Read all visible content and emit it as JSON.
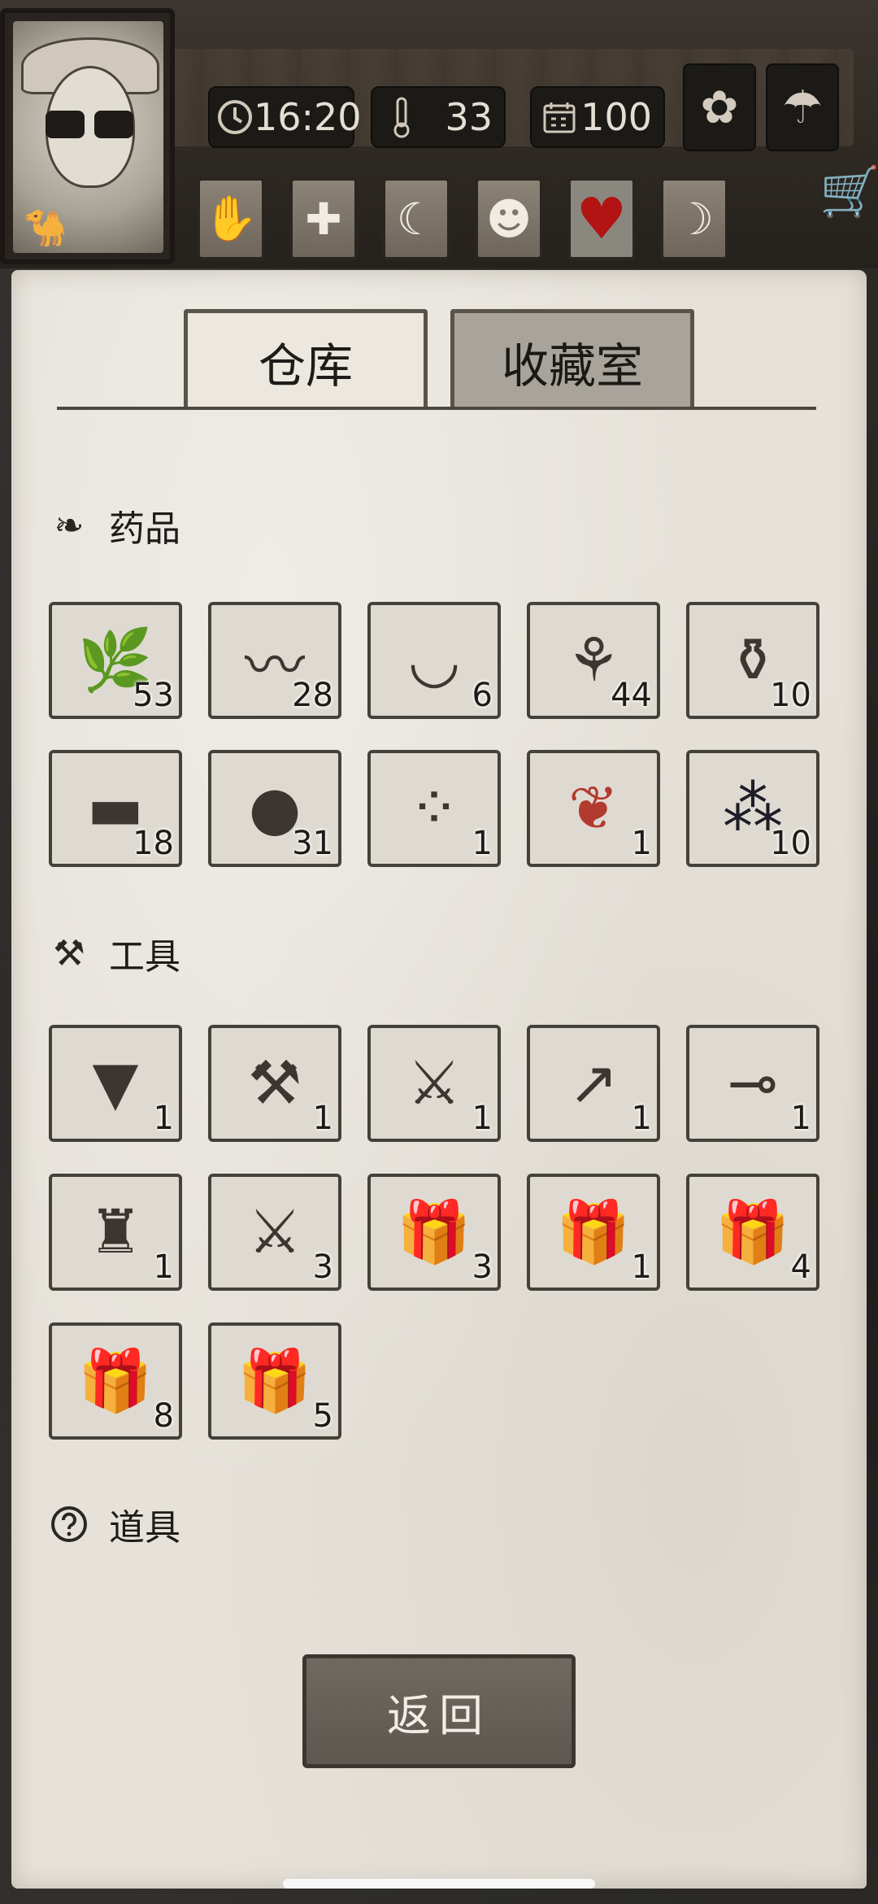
{
  "hud": {
    "time": "16:20",
    "temperature": "33",
    "day": "100"
  },
  "status_icons": [
    "hand-icon",
    "medical-cross-icon",
    "stomach-icon",
    "head-icon",
    "heart-icon",
    "moon-icon"
  ],
  "tabs": {
    "warehouse": "仓库",
    "collection": "收藏室"
  },
  "sections": {
    "medicine": {
      "title": "药品",
      "items": [
        {
          "name": "herb-branch",
          "qty": "53"
        },
        {
          "name": "bandage",
          "qty": "28"
        },
        {
          "name": "bowl",
          "qty": "6"
        },
        {
          "name": "ginseng-root",
          "qty": "44"
        },
        {
          "name": "medicine-bottle",
          "qty": "10"
        },
        {
          "name": "plaster",
          "qty": "18"
        },
        {
          "name": "pill-ball",
          "qty": "31"
        },
        {
          "name": "black-pills",
          "qty": "1"
        },
        {
          "name": "red-berries",
          "qty": "1"
        },
        {
          "name": "dark-berries",
          "qty": "10"
        }
      ]
    },
    "tools": {
      "title": "工具",
      "items": [
        {
          "name": "vest",
          "qty": "1"
        },
        {
          "name": "axe",
          "qty": "1"
        },
        {
          "name": "double-axe",
          "qty": "1"
        },
        {
          "name": "spear",
          "qty": "1"
        },
        {
          "name": "frying-pan",
          "qty": "1"
        },
        {
          "name": "fur-coat",
          "qty": "1"
        },
        {
          "name": "broad-sword",
          "qty": "3"
        },
        {
          "name": "food-gift-box",
          "qty": "3"
        },
        {
          "name": "medical-gift-box",
          "qty": "1"
        },
        {
          "name": "weapon-gift-box",
          "qty": "4"
        },
        {
          "name": "tool-gift-box",
          "qty": "8"
        },
        {
          "name": "lumber-gift-box",
          "qty": "5"
        }
      ]
    },
    "props": {
      "title": "道具"
    }
  },
  "back_button": "返回",
  "colors": {
    "paper": "#e6e2da",
    "heart": "#b21313",
    "button": "#706960"
  }
}
